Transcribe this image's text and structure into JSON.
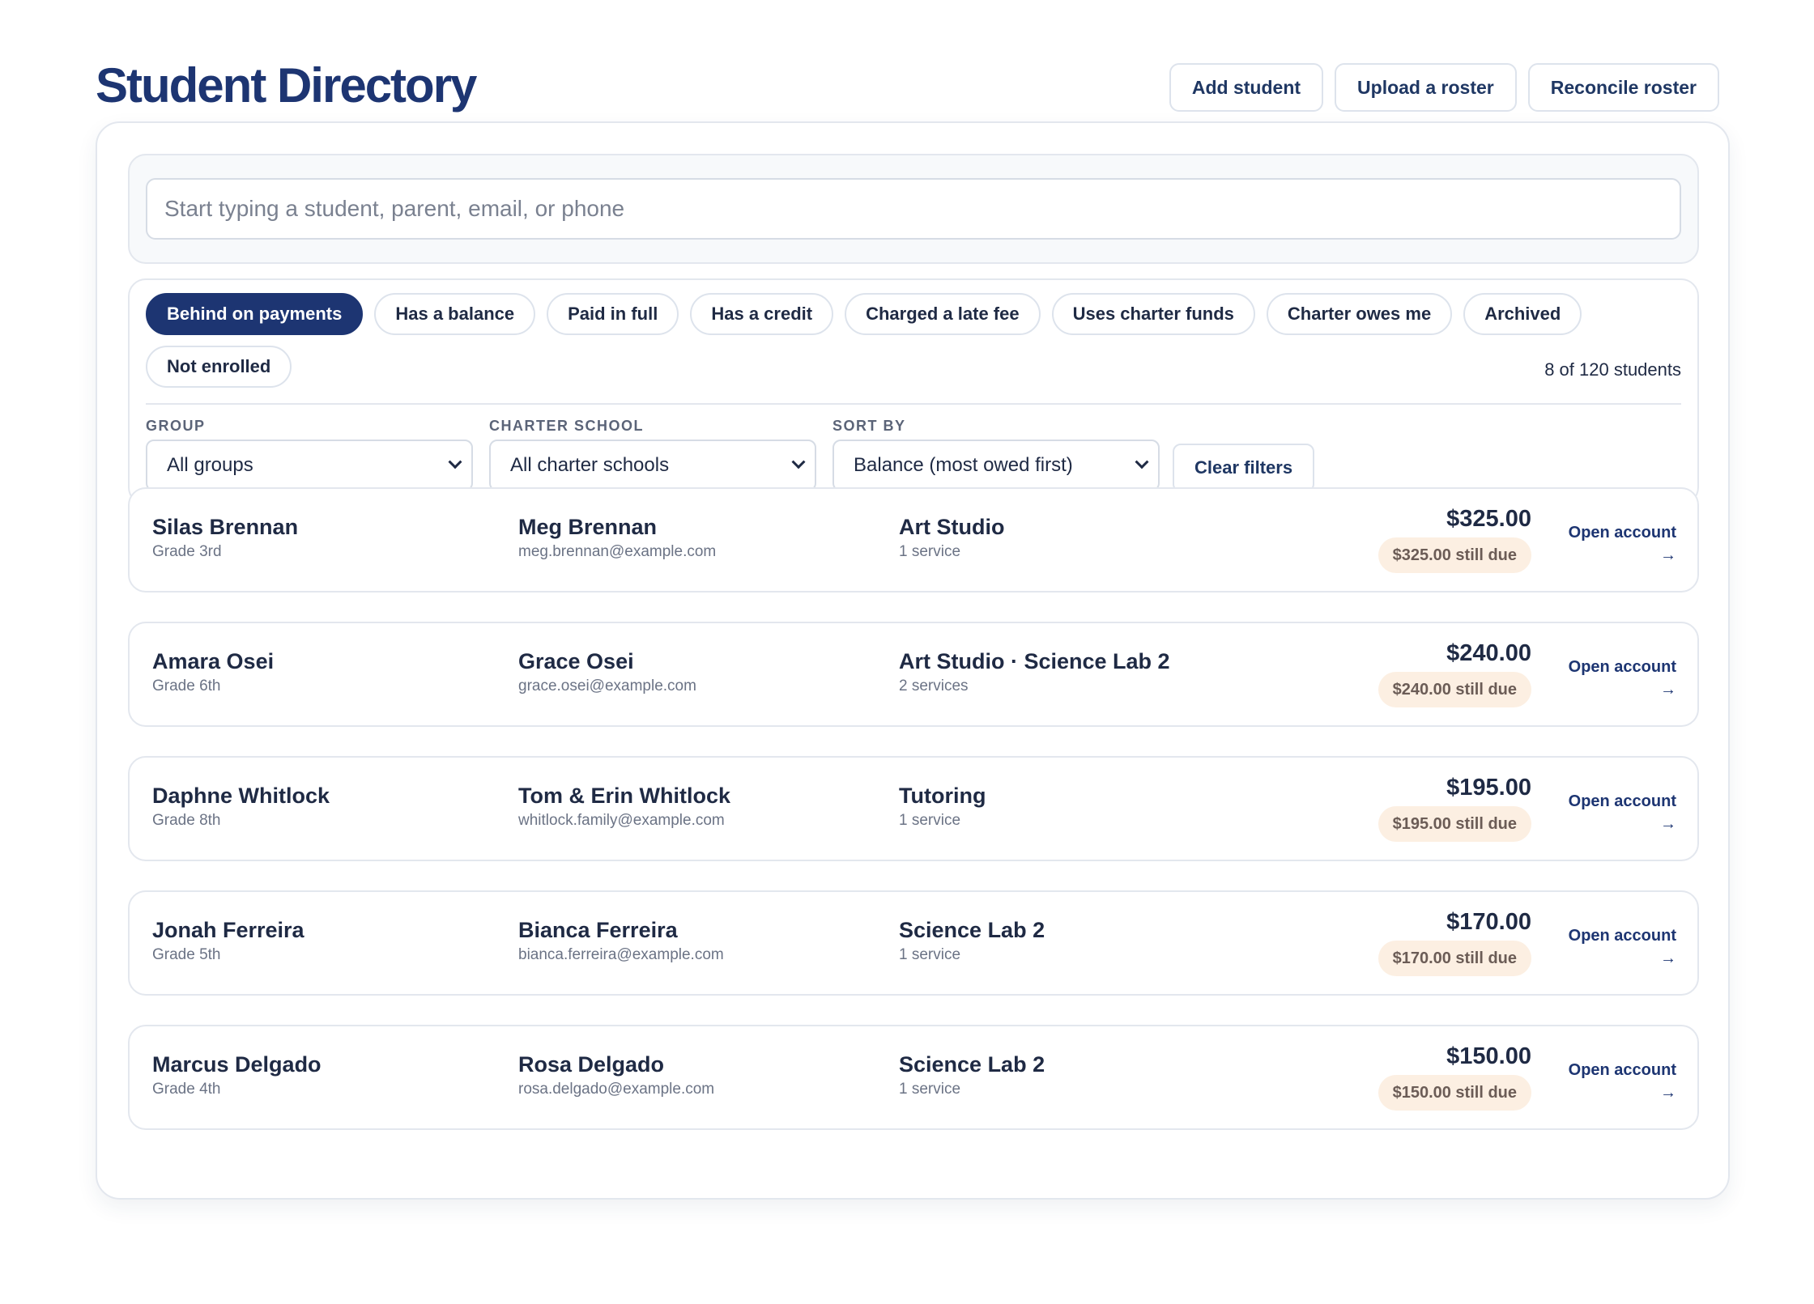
{
  "page_title": "Student Directory",
  "header_actions": {
    "add_student": "Add student",
    "upload_roster": "Upload a roster",
    "reconcile_roster": "Reconcile roster"
  },
  "search": {
    "placeholder": "Start typing a student, parent, email, or phone",
    "value": ""
  },
  "filter_chips": [
    {
      "label": "Behind on payments",
      "active": true
    },
    {
      "label": "Has a balance",
      "active": false
    },
    {
      "label": "Paid in full",
      "active": false
    },
    {
      "label": "Has a credit",
      "active": false
    },
    {
      "label": "Charged a late fee",
      "active": false
    },
    {
      "label": "Uses charter funds",
      "active": false
    },
    {
      "label": "Charter owes me",
      "active": false
    },
    {
      "label": "Archived",
      "active": false
    },
    {
      "label": "Not enrolled",
      "active": false
    }
  ],
  "result_count": "8 of 120 students",
  "filters": {
    "group": {
      "label": "GROUP",
      "value": "All groups"
    },
    "charter_school": {
      "label": "CHARTER SCHOOL",
      "value": "All charter schools"
    },
    "sort_by": {
      "label": "SORT BY",
      "value": "Balance (most owed first)"
    },
    "clear_label": "Clear filters"
  },
  "open_account_label": "Open account",
  "arrow_glyph": "→",
  "students": [
    {
      "name": "Silas Brennan",
      "grade": "Grade 3rd",
      "parent": "Meg Brennan",
      "email": "meg.brennan@example.com",
      "services": "Art Studio",
      "service_count": "1 service",
      "balance": "$325.00",
      "due": "$325.00 still due"
    },
    {
      "name": "Amara Osei",
      "grade": "Grade 6th",
      "parent": "Grace Osei",
      "email": "grace.osei@example.com",
      "services": "Art Studio · Science Lab 2",
      "service_count": "2 services",
      "balance": "$240.00",
      "due": "$240.00 still due"
    },
    {
      "name": "Daphne Whitlock",
      "grade": "Grade 8th",
      "parent": "Tom & Erin Whitlock",
      "email": "whitlock.family@example.com",
      "services": "Tutoring",
      "service_count": "1 service",
      "balance": "$195.00",
      "due": "$195.00 still due"
    },
    {
      "name": "Jonah Ferreira",
      "grade": "Grade 5th",
      "parent": "Bianca Ferreira",
      "email": "bianca.ferreira@example.com",
      "services": "Science Lab 2",
      "service_count": "1 service",
      "balance": "$170.00",
      "due": "$170.00 still due"
    },
    {
      "name": "Marcus Delgado",
      "grade": "Grade 4th",
      "parent": "Rosa Delgado",
      "email": "rosa.delgado@example.com",
      "services": "Science Lab 2",
      "service_count": "1 service",
      "balance": "$150.00",
      "due": "$150.00 still due"
    }
  ]
}
